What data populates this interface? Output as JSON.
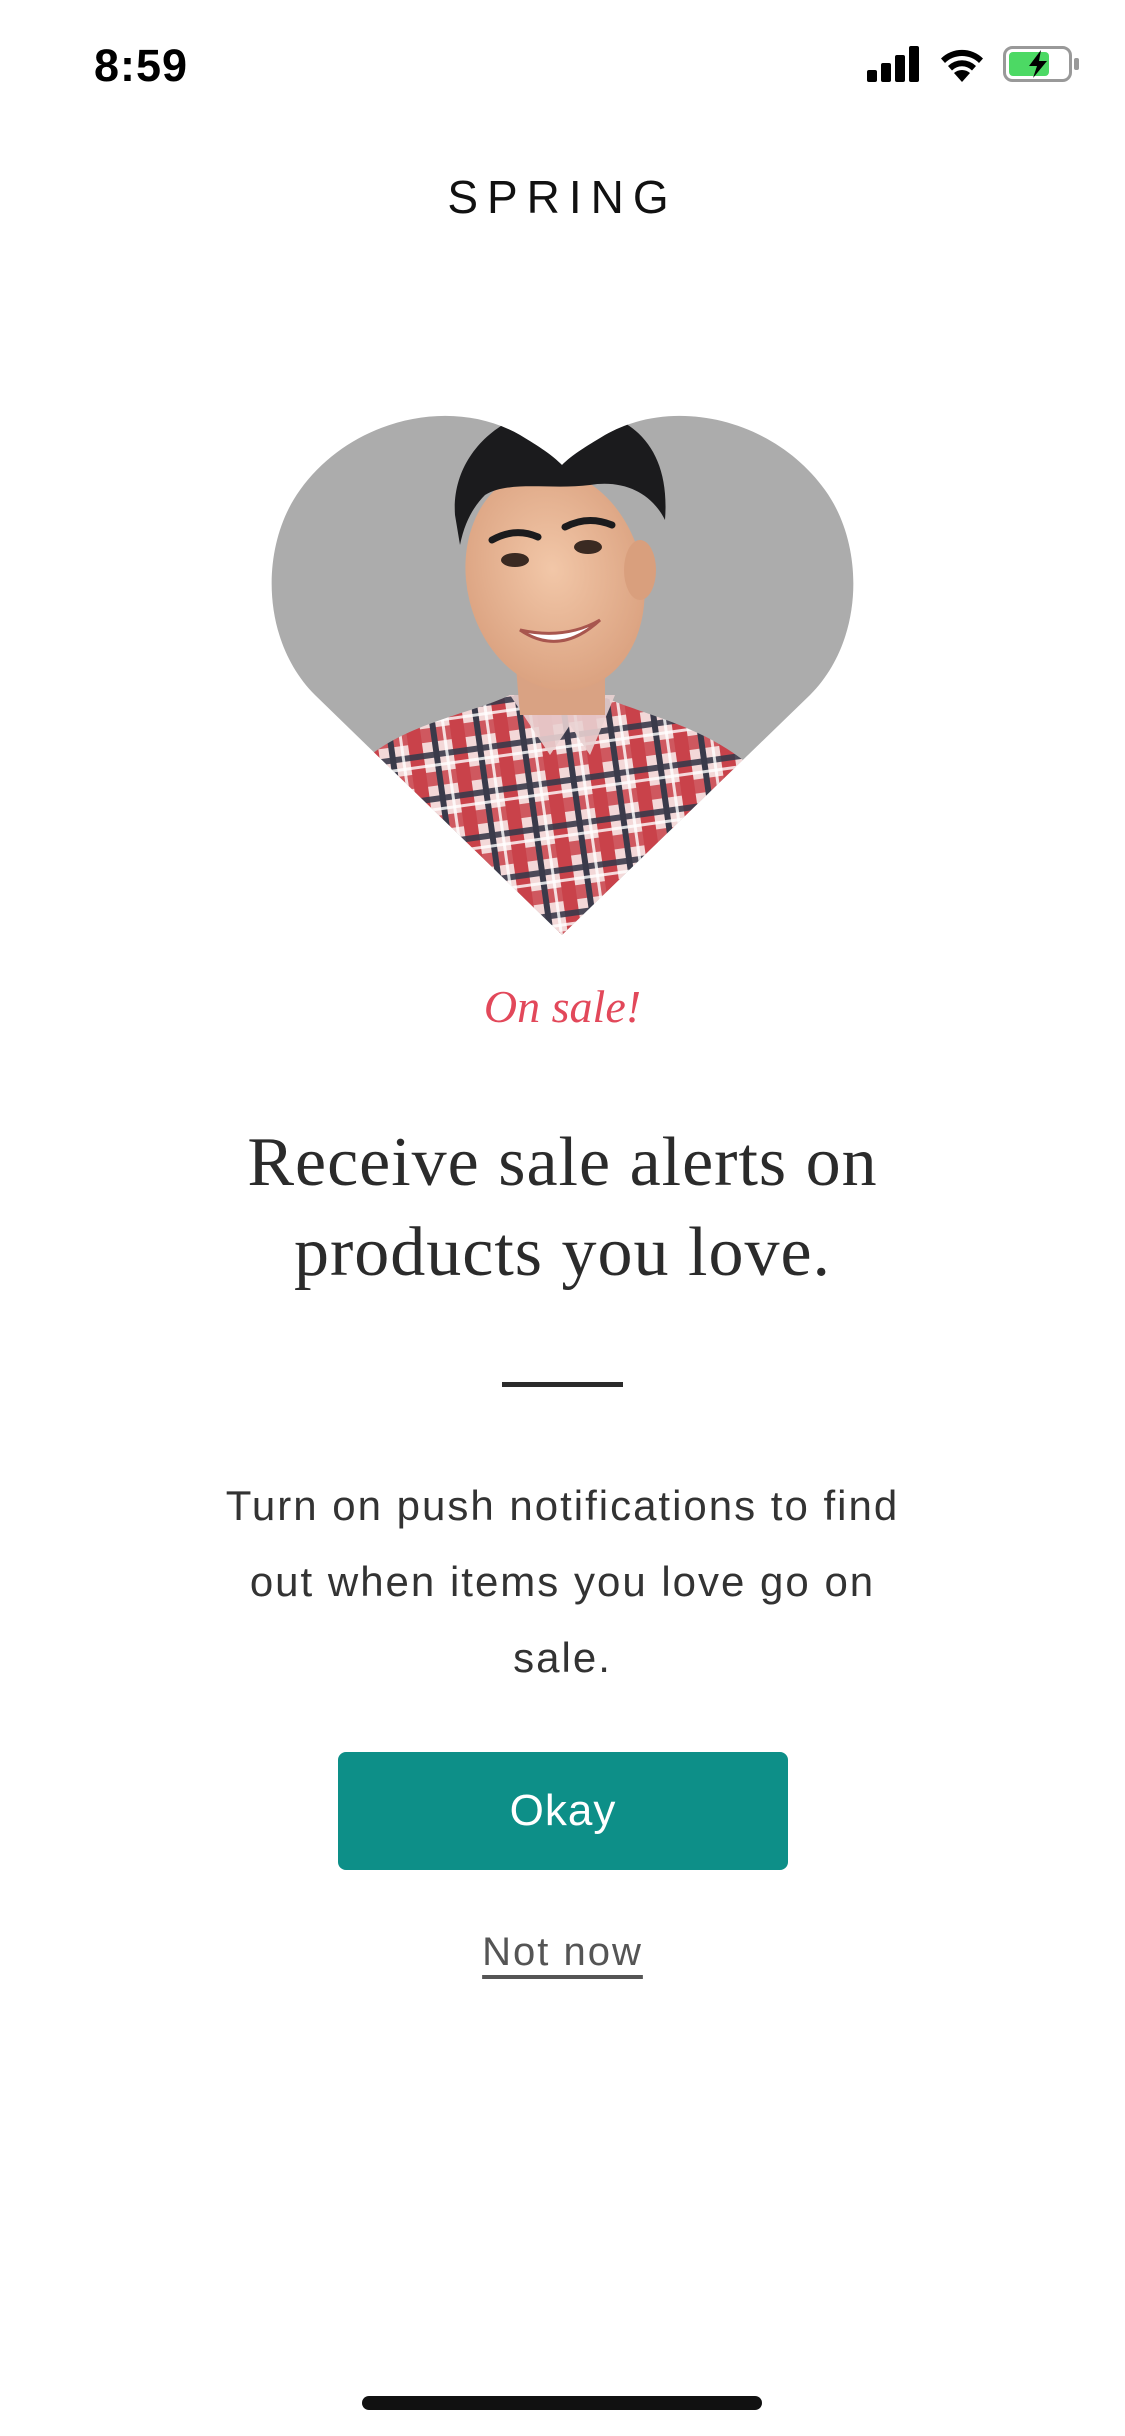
{
  "status_bar": {
    "time": "8:59",
    "icons": [
      "cellular-signal-icon",
      "wifi-icon",
      "battery-charging-icon"
    ],
    "battery_color": "#4cd964"
  },
  "brand": {
    "name": "SPRING"
  },
  "hero": {
    "icon": "heart-shaped-photo",
    "background_color": "#acacac"
  },
  "promo": {
    "tag": "On sale!",
    "tag_color": "#e2485a",
    "headline": "Receive sale alerts on products you love.",
    "body": "Turn on push notifications to find out when items you love go on sale."
  },
  "actions": {
    "okay_label": "Okay",
    "okay_color": "#0d8f88",
    "not_now_label": "Not now"
  }
}
